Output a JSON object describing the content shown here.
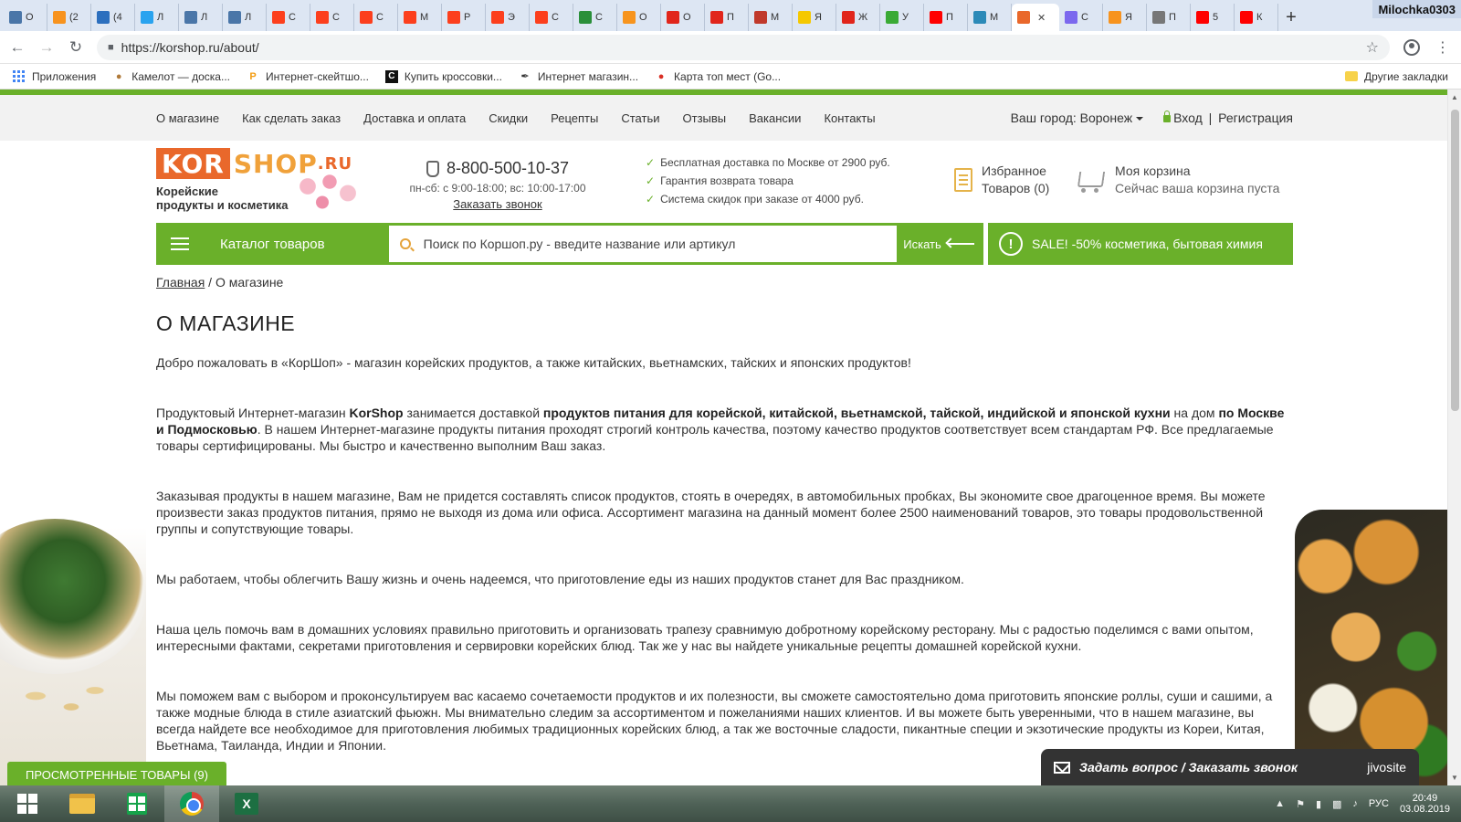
{
  "browser": {
    "profile_name": "Milochka0303",
    "tabs": [
      {
        "label": "О",
        "color": "#4a76a8"
      },
      {
        "label": "(2",
        "color": "#f7931e"
      },
      {
        "label": "(4",
        "color": "#2c6fbe"
      },
      {
        "label": "Л",
        "color": "#29a3ef"
      },
      {
        "label": "Л",
        "color": "#4a76a8"
      },
      {
        "label": "Л",
        "color": "#4a76a8"
      },
      {
        "label": "С",
        "color": "#fc3f1d"
      },
      {
        "label": "С",
        "color": "#fc3f1d"
      },
      {
        "label": "С",
        "color": "#fc3f1d"
      },
      {
        "label": "М",
        "color": "#fc3f1d"
      },
      {
        "label": "Р",
        "color": "#fc3f1d"
      },
      {
        "label": "Э",
        "color": "#fc3f1d"
      },
      {
        "label": "С",
        "color": "#fc3f1d"
      },
      {
        "label": "С",
        "color": "#2a8f3a"
      },
      {
        "label": "О",
        "color": "#f7941d"
      },
      {
        "label": "О",
        "color": "#e1251b"
      },
      {
        "label": "П",
        "color": "#e1251b"
      },
      {
        "label": "М",
        "color": "#c0392b"
      },
      {
        "label": "Я",
        "color": "#f5c800"
      },
      {
        "label": "Ж",
        "color": "#e1251b"
      },
      {
        "label": "У",
        "color": "#3aaa35"
      },
      {
        "label": "П",
        "color": "#ff0000"
      },
      {
        "label": "М",
        "color": "#2c8ab8"
      },
      {
        "label": "",
        "color": "#e9682b"
      },
      {
        "label": "С",
        "color": "#7b68ee"
      },
      {
        "label": "Я",
        "color": "#f7931e"
      },
      {
        "label": "П",
        "color": "#777777"
      },
      {
        "label": "5",
        "color": "#ff0000"
      },
      {
        "label": "К",
        "color": "#ff0000"
      }
    ],
    "url": "https://korshop.ru/about/",
    "bookmarks": [
      {
        "label": "Приложения"
      },
      {
        "label": "Камелот — доска..."
      },
      {
        "label": "Интернет-скейтшо..."
      },
      {
        "label": "Купить кроссовки..."
      },
      {
        "label": "Интернет магазин..."
      },
      {
        "label": "Карта топ мест (Go..."
      }
    ],
    "other_bookmarks": "Другие закладки"
  },
  "site": {
    "topnav": [
      "О магазине",
      "Как сделать заказ",
      "Доставка и оплата",
      "Скидки",
      "Рецепты",
      "Статьи",
      "Отзывы",
      "Вакансии",
      "Контакты"
    ],
    "city_label": "Ваш город: Воронеж",
    "login": "Вход",
    "separator": "|",
    "register": "Регистрация",
    "logo": {
      "kor": "KOR",
      "shop": "SHOP",
      "ru": ".RU",
      "tagline_1": "Корейские",
      "tagline_2": "продукты и косметика"
    },
    "phone": "8-800-500-10-37",
    "hours": "пн-сб: с 9:00-18:00; вс: 10:00-17:00",
    "callback": "Заказать звонок",
    "benefits": [
      "Бесплатная доставка по Москве от 2900 руб.",
      "Гарантия возврата товара",
      "Система скидок при заказе от 4000 руб."
    ],
    "favorites": {
      "line1": "Избранное",
      "line2": "Товаров (0)"
    },
    "cart": {
      "line1": "Моя корзина",
      "line2": "Сейчас ваша корзина пуста"
    },
    "catalog_label": "Каталог товаров",
    "search_placeholder": "Поиск по Коршоп.ру - введите название или артикул",
    "search_button": "Искать",
    "sale_text": "SALE! -50% косметика, бытовая химия",
    "sale_icon_glyph": "!",
    "breadcrumb": {
      "home": "Главная",
      "sep": " / ",
      "current": "О магазине"
    },
    "page_title": "О МАГАЗИНЕ",
    "paragraphs": {
      "p1": "Добро пожаловать в «КорШоп» - магазин корейских продуктов, а также китайских, вьетнамских, тайских и японских продуктов!",
      "p2_a": "Продуктовый Интернет-магазин ",
      "p2_b": "KorShop",
      "p2_c": " занимается доставкой ",
      "p2_d": "продуктов питания для корейской, китайской, вьетнамской, тайской, индийской и японской кухни",
      "p2_e": " на дом ",
      "p2_f": "по Москве и Подмосковью",
      "p2_g": ". В нашем Интернет-магазине продукты питания проходят строгий контроль качества, поэтому качество продуктов соответствует всем стандартам РФ. Все предлагаемые товары сертифицированы. Мы быстро и качественно выполним Ваш заказ.",
      "p3": "Заказывая продукты в нашем магазине, Вам не придется составлять список продуктов, стоять в очередях, в автомобильных пробках, Вы экономите свое драгоценное время. Вы можете произвести заказ продуктов питания, прямо не выходя из дома или офиса. Ассортимент магазина на данный момент более 2500 наименований товаров, это товары продовольственной группы и сопутствующие товары.",
      "p4": "Мы работаем, чтобы облегчить Вашу жизнь и очень надеемся, что приготовление еды из наших продуктов станет для Вас праздником.",
      "p5": "Наша цель помочь вам в домашних условиях правильно приготовить и организовать трапезу сравнимую добротному корейскому ресторану. Мы с радостью поделимся с вами опытом, интересными фактами, секретами приготовления и сервировки корейских блюд. Так же у нас вы найдете уникальные рецепты домашней корейской кухни.",
      "p6": "Мы поможем вам с выбором и проконсультируем вас касаемо сочетаемости продуктов и их полезности, вы сможете самостоятельно дома приготовить японские роллы, суши и сашими, а также модные блюда в стиле азиатский фьюжн. Мы внимательно следим за ассортиментом и пожеланиями наших клиентов. И вы можете быть уверенными, что в нашем магазине, вы всегда найдете все необходимое для приготовления любимых традиционных корейских блюд, а так же восточные сладости, пикантные специи и экзотические продукты из Кореи, Китая, Вьетнама, Таиланда, Индии и Японии."
    },
    "viewed_products": "ПРОСМОТРЕННЫЕ ТОВАРЫ (9)",
    "chat_label": "Задать вопрос / Заказать звонок",
    "chat_brand": "jivosite"
  },
  "taskbar": {
    "time": "20:49",
    "date": "03.08.2019",
    "tray_text": "РУС"
  }
}
